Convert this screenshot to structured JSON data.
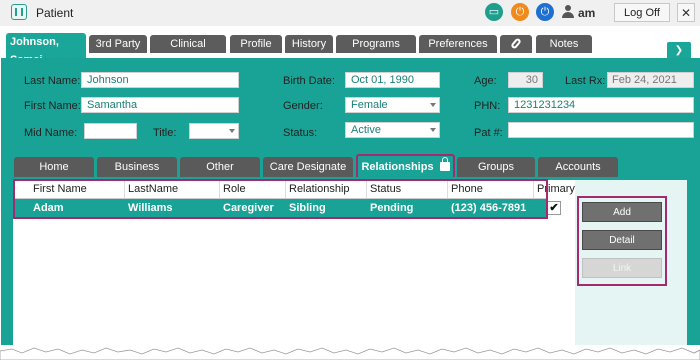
{
  "window": {
    "title": "Patient",
    "user": "am",
    "logoff_label": "Log Off",
    "close_label": "✕"
  },
  "main_tabs": [
    {
      "label": "Johnson, Samai",
      "active": true
    },
    {
      "label": "3rd Party"
    },
    {
      "label": "Clinical"
    },
    {
      "label": "Profile"
    },
    {
      "label": "History"
    },
    {
      "label": "Programs"
    },
    {
      "label": "Preferences"
    },
    {
      "label": "",
      "icon": "paperclip-icon"
    },
    {
      "label": "Notes"
    }
  ],
  "form": {
    "last_name_label": "Last Name:",
    "last_name": "Johnson",
    "first_name_label": "First Name:",
    "first_name": "Samantha",
    "mid_name_label": "Mid Name:",
    "mid_name": "",
    "title_label": "Title:",
    "title": "",
    "birth_date_label": "Birth Date:",
    "birth_date": "Oct 01, 1990",
    "gender_label": "Gender:",
    "gender": "Female",
    "status_label": "Status:",
    "status": "Active",
    "age_label": "Age:",
    "age": "30",
    "last_rx_label": "Last Rx:",
    "last_rx": "Feb 24, 2021",
    "phn_label": "PHN:",
    "phn": "1231231234",
    "pat_label": "Pat #:",
    "pat": ""
  },
  "sub_tabs": [
    {
      "label": "Home"
    },
    {
      "label": "Business"
    },
    {
      "label": "Other"
    },
    {
      "label": "Care Designate"
    },
    {
      "label": "Relationships",
      "active": true
    },
    {
      "label": "Groups"
    },
    {
      "label": "Accounts"
    }
  ],
  "grid": {
    "columns": [
      "First Name",
      "LastName",
      "Role",
      "Relationship",
      "Status",
      "Phone",
      "Primary"
    ],
    "rows": [
      {
        "first_name": "Adam",
        "last_name": "Williams",
        "role": "Caregiver",
        "relationship": "Sibling",
        "status": "Pending Consent",
        "phone": "(123) 456-7891",
        "primary": "✔"
      }
    ]
  },
  "buttons": {
    "add": "Add",
    "detail": "Detail",
    "link": "Link"
  },
  "colors": {
    "accent": "#19a396",
    "highlight_frame": "#a32a6e",
    "tab_dark": "#5a5a5a"
  }
}
